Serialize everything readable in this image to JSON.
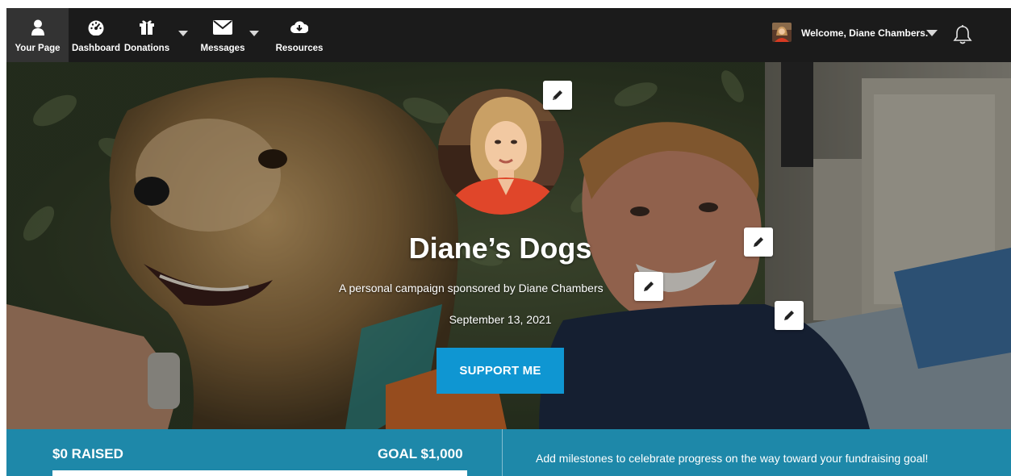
{
  "nav": {
    "items": [
      {
        "label": "Your Page",
        "icon": "person-icon"
      },
      {
        "label": "Dashboard",
        "icon": "gauge-icon"
      },
      {
        "label": "Donations",
        "icon": "gift-icon"
      },
      {
        "label": "Messages",
        "icon": "envelope-icon"
      },
      {
        "label": "Resources",
        "icon": "cloud-download-icon"
      }
    ],
    "welcome": "Welcome, Diane Chambers.",
    "bell_icon": "bell-icon"
  },
  "hero": {
    "title": "Diane’s Dogs",
    "subtitle": "A personal campaign sponsored by Diane Chambers",
    "date": "September 13, 2021",
    "support_label": "SUPPORT ME",
    "edit_icon": "pencil-icon"
  },
  "progress": {
    "raised_label": "$0 RAISED",
    "goal_label": "GOAL $1,000",
    "fraction": 0,
    "milestone_text": "Add milestones to celebrate progress on the way toward your fundraising goal!"
  },
  "colors": {
    "nav_bg": "#1b1b1b",
    "accent": "#0f96d2",
    "progress_bg": "#1e88a9"
  }
}
